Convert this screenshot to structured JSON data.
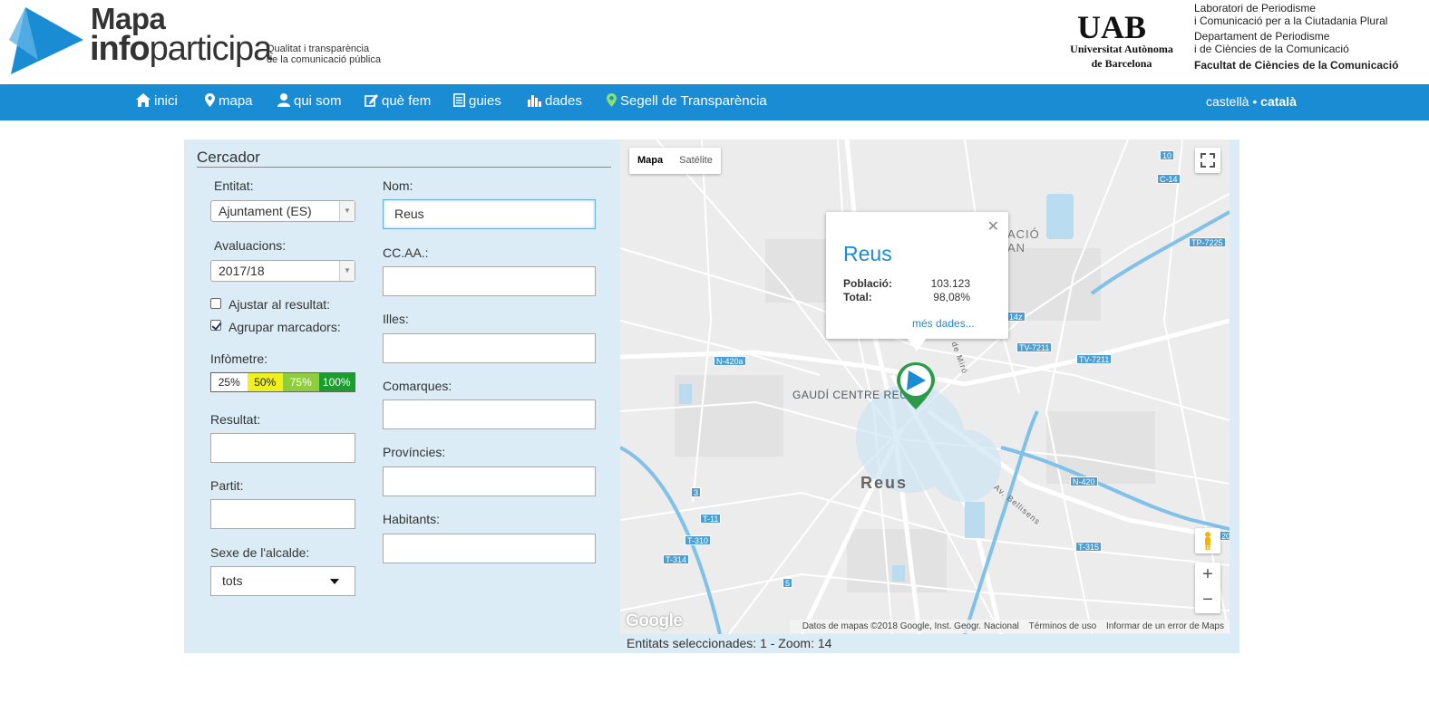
{
  "header": {
    "logo_line1": "Mapa",
    "logo_line2_bold": "info",
    "logo_line2_rest": "participa",
    "tagline1": "Qualitat i transparència",
    "tagline2": "de la comunicació pública",
    "uab_logo": "UAB",
    "uab_name1": "Universitat Autònoma",
    "uab_name2": "de Barcelona",
    "lab1": "Laboratori de Periodisme",
    "lab2": "i Comunicació per a la Ciutadania Plural",
    "lab3": "Departament de Periodisme",
    "lab4": "i de Ciències de la Comunicació",
    "lab5": "Facultat de Ciències de la Comunicació"
  },
  "nav": {
    "items": [
      {
        "label": "inici",
        "icon": "home-icon"
      },
      {
        "label": "mapa",
        "icon": "map-pin-icon"
      },
      {
        "label": "qui som",
        "icon": "user-icon"
      },
      {
        "label": "què fem",
        "icon": "edit-icon"
      },
      {
        "label": "guies",
        "icon": "list-icon"
      },
      {
        "label": "dades",
        "icon": "bar-chart-icon"
      },
      {
        "label": "Segell de Transparència",
        "icon": "green-pin-icon"
      }
    ],
    "lang_castella": "castellà",
    "lang_sep": "•",
    "lang_catala": "català"
  },
  "search": {
    "title": "Cercador",
    "entitat_label": "Entitat:",
    "entitat_value": "Ajuntament (ES)",
    "avaluacions_label": "Avaluacions:",
    "avaluacions_value": "2017/18",
    "ajustar_label": "Ajustar al resultat:",
    "agrupar_label": "Agrupar marcadors:",
    "infometre_label": "Infòmetre:",
    "infometre": [
      {
        "label": "25%",
        "color": "#ffffff",
        "text": "#222222"
      },
      {
        "label": "50%",
        "color": "#f0f020",
        "text": "#222222"
      },
      {
        "label": "75%",
        "color": "#8fcd3a",
        "text": "#ffffff"
      },
      {
        "label": "100%",
        "color": "#1b9e2e",
        "text": "#ffffff"
      }
    ],
    "resultat_label": "Resultat:",
    "partit_label": "Partit:",
    "sexe_label": "Sexe de l'alcalde:",
    "sexe_value": "tots",
    "nom_label": "Nom:",
    "nom_value": "Reus",
    "ccaa_label": "CC.AA.:",
    "illes_label": "Illes:",
    "comarques_label": "Comarques:",
    "provincies_label": "Províncies:",
    "habitants_label": "Habitants:"
  },
  "map": {
    "type_map": "Mapa",
    "type_sat": "Satélite",
    "popup_title": "Reus",
    "poblacio_label": "Població:",
    "poblacio_value": "103.123",
    "total_label": "Total:",
    "total_value": "98,08%",
    "more_link": "més dades...",
    "label_reus": "Reus",
    "label_gaudi": "GAUDÍ CENTRE REUS",
    "label_acio": "ACIÓ",
    "label_an": "AN",
    "label_miro": "de Miró",
    "label_bellisens": "Av. Bellisens",
    "roads": [
      "10",
      "C-14",
      "TP-7225",
      "N-420a",
      "TV-7211",
      "TV-7211",
      "N-420",
      "T-11",
      "T-310",
      "T-314",
      "T-315",
      "3",
      "5",
      "14z",
      "20"
    ],
    "google": "Google",
    "attrib1": "Datos de mapas ©2018 Google, Inst. Geogr. Nacional",
    "attrib2": "Términos de uso",
    "attrib3": "Informar de un error de Maps",
    "zoom_in": "+",
    "zoom_out": "−"
  },
  "status": "Entitats seleccionades: 1 - Zoom: 14"
}
